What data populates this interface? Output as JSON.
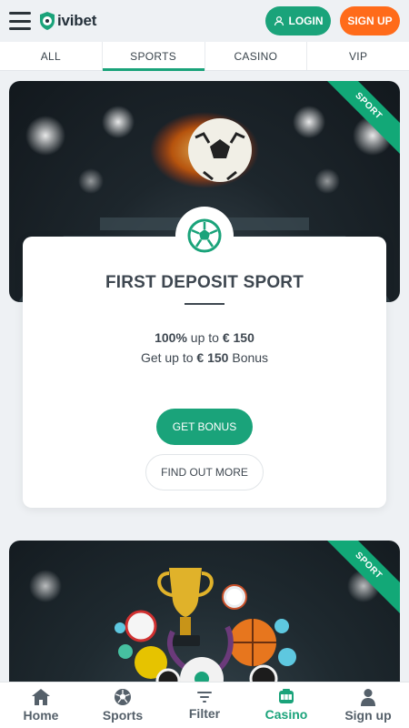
{
  "header": {
    "logo_text": "ivibet",
    "login_label": "LOGIN",
    "signup_label": "SIGN UP"
  },
  "tabs": [
    {
      "label": "ALL",
      "active": false
    },
    {
      "label": "SPORTS",
      "active": true
    },
    {
      "label": "CASINO",
      "active": false
    },
    {
      "label": "VIP",
      "active": false
    }
  ],
  "promos": [
    {
      "ribbon": "SPORT",
      "title": "FIRST DEPOSIT SPORT",
      "line1_prefix": "100%",
      "line1_mid": " up to ",
      "line1_amount": "€ 150",
      "line2_prefix": "Get up to ",
      "line2_amount": "€ 150",
      "line2_suffix": " Bonus",
      "primary_button": "GET BONUS",
      "secondary_button": "FIND OUT MORE"
    },
    {
      "ribbon": "SPORT"
    }
  ],
  "bottom_nav": [
    {
      "label": "Home",
      "icon": "home-icon",
      "active": false
    },
    {
      "label": "Sports",
      "icon": "soccer-ball-icon",
      "active": false
    },
    {
      "label": "Filter",
      "icon": "filter-icon",
      "active": false
    },
    {
      "label": "Casino",
      "icon": "slot-machine-icon",
      "active": true
    },
    {
      "label": "Sign up",
      "icon": "user-icon",
      "active": false
    }
  ],
  "colors": {
    "accent_green": "#1aa37a",
    "accent_orange": "#ff6b1a",
    "text_dark": "#3e4750",
    "background": "#eef1f4"
  }
}
